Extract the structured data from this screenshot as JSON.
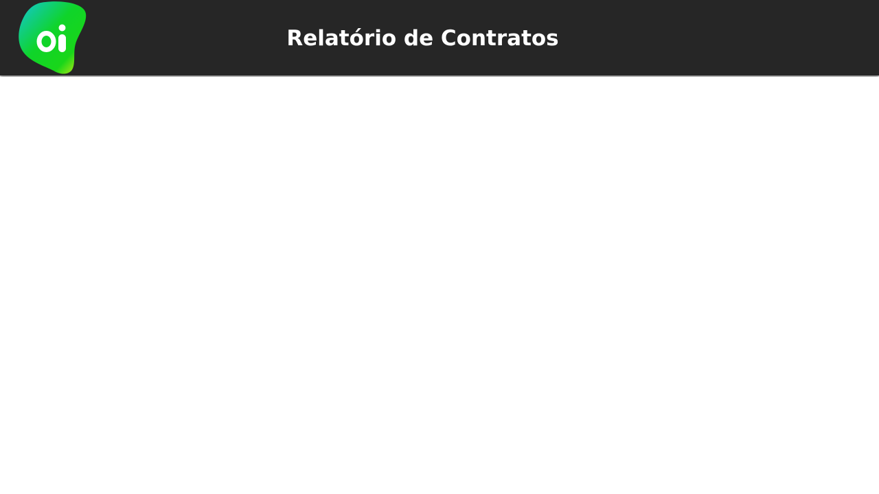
{
  "header": {
    "title": "Relatório de Contratos",
    "background_color": "#262626",
    "title_color": "#ffffff"
  },
  "logo": {
    "text": "oi",
    "icon": "oi-logo",
    "gradient_colors": [
      "#13c6d8",
      "#0fd42a",
      "#f2ef13"
    ]
  },
  "main": {}
}
